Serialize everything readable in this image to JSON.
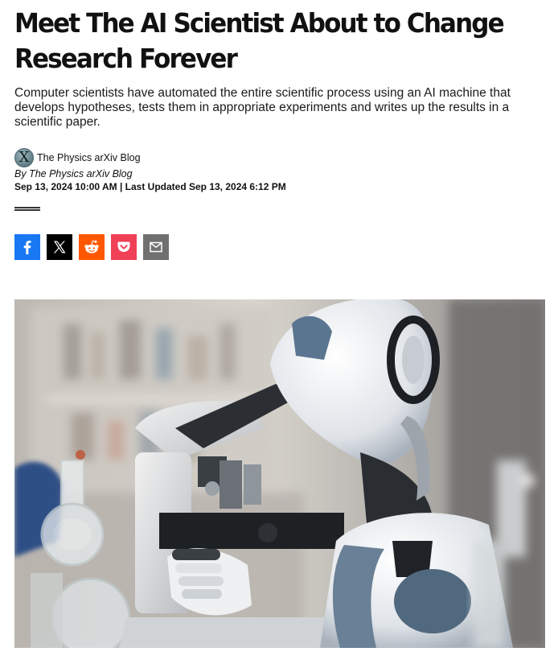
{
  "article": {
    "headline": "Meet The AI Scientist About to Change Research Forever",
    "dek": "Computer scientists have automated the entire scientific process using an AI machine that develops hypotheses, tests them in appropriate experiments and writes up the results in a scientific paper.",
    "author": {
      "avatar_letter": "X",
      "name": "The Physics arXiv Blog",
      "byline": "By The Physics arXiv Blog"
    },
    "dateline": "Sep 13, 2024 10:00 AM | Last Updated Sep 13, 2024 6:12 PM"
  },
  "share": {
    "buttons": [
      {
        "icon": "facebook-icon",
        "color": "#1877f2"
      },
      {
        "icon": "x-icon",
        "color": "#000000"
      },
      {
        "icon": "reddit-icon",
        "color": "#ff5700"
      },
      {
        "icon": "pocket-icon",
        "color": "#ef4056"
      },
      {
        "icon": "email-icon",
        "color": "#707070"
      }
    ]
  },
  "hero_image": {
    "subject": "humanoid robot looking into a microscope in a laboratory"
  }
}
